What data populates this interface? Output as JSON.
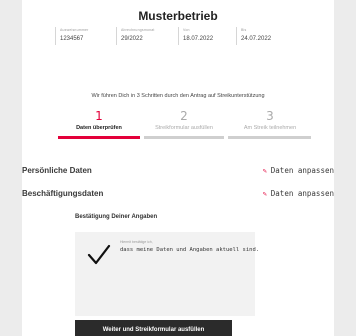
{
  "company": "Musterbetrieb",
  "meta": [
    {
      "label": "Ausweisnummer",
      "value": "1234567"
    },
    {
      "label": "Abrechnungsmonat",
      "value": "29/2022"
    },
    {
      "label": "Von",
      "value": "18.07.2022"
    },
    {
      "label": "Bis",
      "value": "24.07.2022"
    }
  ],
  "intro": "Wir führen Dich in 3 Schritten durch den Antrag auf Streikunterstützung",
  "steps": [
    {
      "num": "1",
      "label": "Daten überprüfen",
      "active": true
    },
    {
      "num": "2",
      "label": "Streikformular ausfüllen",
      "active": false
    },
    {
      "num": "3",
      "label": "Am Streik teilnehmen",
      "active": false
    }
  ],
  "sections": [
    {
      "title": "Persönliche Daten",
      "action": "Daten anpassen"
    },
    {
      "title": "Beschäftigungsdaten",
      "action": "Daten anpassen"
    }
  ],
  "confirm": {
    "heading": "Bestätigung Deiner Angaben",
    "check_label": "Hiermit bestätige ich,",
    "check_text": "dass meine Daten und Angaben aktuell sind.",
    "checked": true
  },
  "submit_label": "Weiter und Streikformular ausfüllen",
  "colors": {
    "accent": "#e3003a",
    "button_bg": "#2b2b2b",
    "page_bg": "#ececec"
  }
}
